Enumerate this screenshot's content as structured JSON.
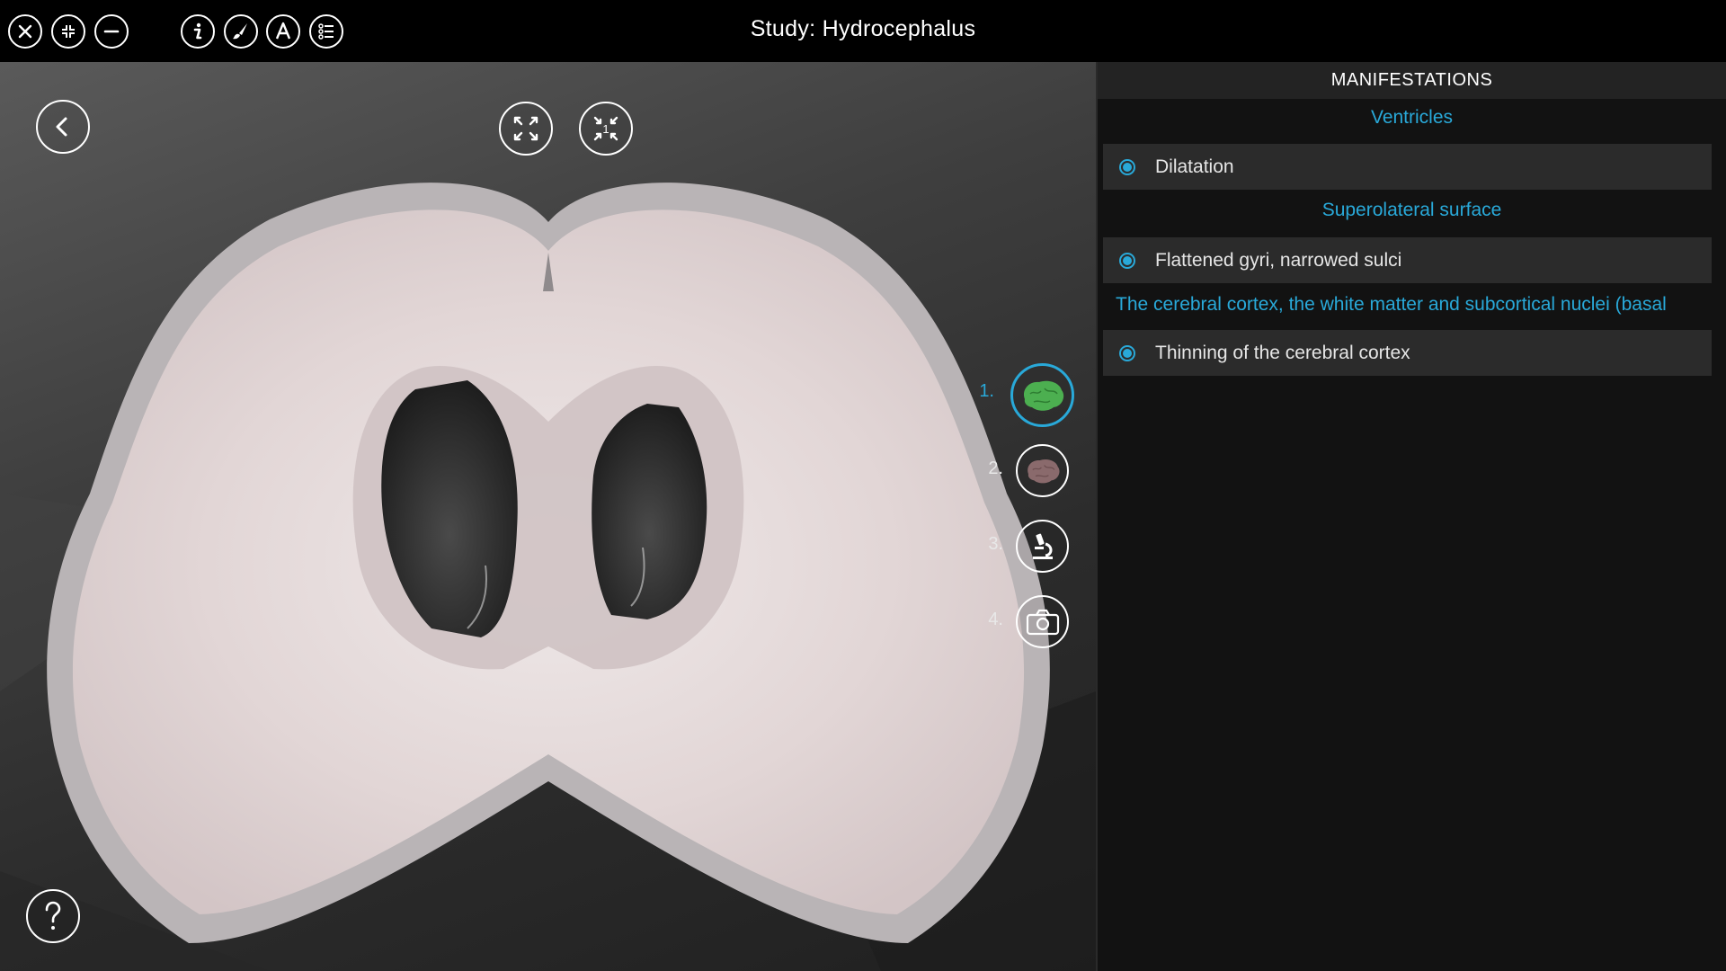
{
  "window": {
    "title": "Study: Hydrocephalus"
  },
  "toolbar": {
    "left_icons": [
      "close-icon",
      "restore-icon",
      "minimize-icon"
    ],
    "tool_icons": [
      "info-icon",
      "brush-icon",
      "annotation-icon",
      "list-icon"
    ]
  },
  "viewport": {
    "fit_badge": "1",
    "modes": [
      {
        "number": "1.",
        "icon": "brain-green-icon",
        "active": true
      },
      {
        "number": "2.",
        "icon": "brain-pink-icon",
        "active": false
      },
      {
        "number": "3.",
        "icon": "microscope-icon",
        "active": false
      },
      {
        "number": "4.",
        "icon": "camera-icon",
        "active": false
      }
    ]
  },
  "panel": {
    "header": "MANIFESTATIONS",
    "sections": [
      {
        "title": "Ventricles",
        "items": [
          "Dilatation"
        ]
      },
      {
        "title": "Superolateral surface",
        "items": [
          "Flattened gyri, narrowed sulci"
        ]
      },
      {
        "title": "The cerebral cortex, the white matter and subcortical nuclei (basal",
        "items": [
          "Thinning of the cerebral cortex"
        ]
      }
    ]
  },
  "colors": {
    "accent": "#29a9d9",
    "panel_bg": "#121212",
    "item_bg": "#2b2b2b",
    "header_bg": "#232323"
  }
}
